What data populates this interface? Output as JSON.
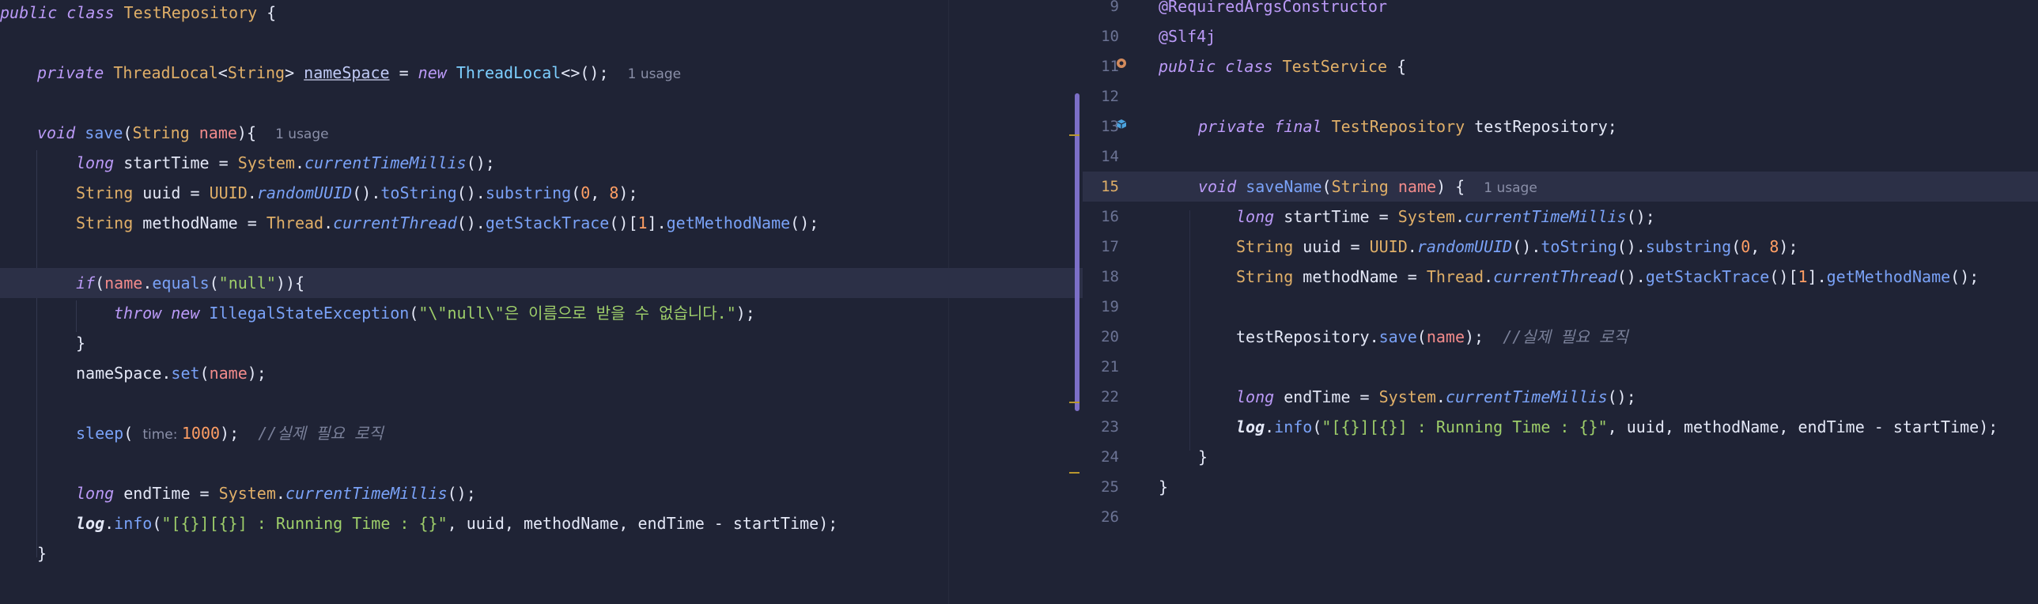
{
  "left_editor": {
    "lines": [
      {
        "segs": [
          [
            "k",
            "public class "
          ],
          [
            "b",
            "TestRepository "
          ],
          [
            "p",
            "{"
          ]
        ]
      },
      {
        "segs": []
      },
      {
        "segs": [
          [
            "k",
            "private "
          ],
          [
            "b",
            "ThreadLocal"
          ],
          [
            "p",
            "<"
          ],
          [
            "b",
            "String"
          ],
          [
            "p",
            "> "
          ],
          [
            "u",
            "nameSpace"
          ],
          [
            "p",
            " = "
          ],
          [
            "k",
            "new "
          ],
          [
            "cls",
            "ThreadLocal"
          ],
          [
            "p",
            "<>();  "
          ],
          [
            "hint",
            "1 usage"
          ]
        ]
      },
      {
        "segs": []
      },
      {
        "segs": [
          [
            "k",
            "void "
          ],
          [
            "f",
            "save"
          ],
          [
            "p",
            "("
          ],
          [
            "b",
            "String "
          ],
          [
            "pr",
            "name"
          ],
          [
            "p",
            "){  "
          ],
          [
            "hint",
            "1 usage"
          ]
        ]
      },
      {
        "segs": [
          [
            "k",
            "long "
          ],
          [
            "p",
            "startTime = "
          ],
          [
            "b",
            "System"
          ],
          [
            "p",
            "."
          ],
          [
            "kf",
            "currentTimeMillis"
          ],
          [
            "p",
            "();"
          ]
        ]
      },
      {
        "segs": [
          [
            "b",
            "String "
          ],
          [
            "p",
            "uuid = "
          ],
          [
            "b",
            "UUID"
          ],
          [
            "p",
            "."
          ],
          [
            "kf",
            "randomUUID"
          ],
          [
            "p",
            "()."
          ],
          [
            "f",
            "toString"
          ],
          [
            "p",
            "()."
          ],
          [
            "f",
            "substring"
          ],
          [
            "p",
            "("
          ],
          [
            "n",
            "0"
          ],
          [
            "p",
            ", "
          ],
          [
            "n",
            "8"
          ],
          [
            "p",
            ");"
          ]
        ]
      },
      {
        "segs": [
          [
            "b",
            "String "
          ],
          [
            "p",
            "methodName = "
          ],
          [
            "b",
            "Thread"
          ],
          [
            "p",
            "."
          ],
          [
            "kf",
            "currentThread"
          ],
          [
            "p",
            "()."
          ],
          [
            "f",
            "getStackTrace"
          ],
          [
            "p",
            "()["
          ],
          [
            "n",
            "1"
          ],
          [
            "p",
            "]."
          ],
          [
            "f",
            "getMethodName"
          ],
          [
            "p",
            "();"
          ]
        ]
      },
      {
        "segs": []
      },
      {
        "segs": [
          [
            "k",
            "if"
          ],
          [
            "p",
            "("
          ],
          [
            "pr",
            "name"
          ],
          [
            "p",
            "."
          ],
          [
            "f",
            "equals"
          ],
          [
            "p",
            "("
          ],
          [
            "s",
            "\"null\""
          ],
          [
            "p",
            ")){"
          ]
        ]
      },
      {
        "segs": [
          [
            "k",
            "throw new "
          ],
          [
            "f",
            "IllegalStateException"
          ],
          [
            "p",
            "("
          ],
          [
            "s",
            "\"\\\"null\\\"은 이름으로 받을 수 없습니다.\""
          ],
          [
            "p",
            ");"
          ]
        ]
      },
      {
        "segs": [
          [
            "p",
            "}"
          ]
        ]
      },
      {
        "segs": [
          [
            "p",
            "nameSpace."
          ],
          [
            "f",
            "set"
          ],
          [
            "p",
            "("
          ],
          [
            "pr",
            "name"
          ],
          [
            "p",
            ");"
          ]
        ]
      },
      {
        "segs": []
      },
      {
        "segs": [
          [
            "f",
            "sleep"
          ],
          [
            "p",
            "( "
          ],
          [
            "hint",
            "time: "
          ],
          [
            "n",
            "1000"
          ],
          [
            "p",
            ");  "
          ],
          [
            "c",
            "//실제 필요 로직"
          ]
        ]
      },
      {
        "segs": []
      },
      {
        "segs": [
          [
            "k",
            "long "
          ],
          [
            "p",
            "endTime = "
          ],
          [
            "b",
            "System"
          ],
          [
            "p",
            "."
          ],
          [
            "kf",
            "currentTimeMillis"
          ],
          [
            "p",
            "();"
          ]
        ]
      },
      {
        "segs": [
          [
            "lg",
            "log"
          ],
          [
            "p",
            "."
          ],
          [
            "f",
            "info"
          ],
          [
            "p",
            "("
          ],
          [
            "s",
            "\"[{}][{}] : Running Time : {}\""
          ],
          [
            "p",
            ", uuid, methodName, endTime - startTime);"
          ]
        ]
      },
      {
        "segs": [
          [
            "p",
            "}"
          ]
        ]
      }
    ]
  },
  "right_editor": {
    "lines": [
      {
        "num": "9",
        "segs": [
          [
            "an",
            "@RequiredArgsConstructor"
          ]
        ]
      },
      {
        "num": "10",
        "segs": [
          [
            "an",
            "@Slf4j"
          ]
        ]
      },
      {
        "num": "11",
        "segs": [
          [
            "k",
            "public class "
          ],
          [
            "b",
            "TestService "
          ],
          [
            "p",
            "{"
          ]
        ]
      },
      {
        "num": "12",
        "segs": []
      },
      {
        "num": "13",
        "segs": [
          [
            "k",
            "private final "
          ],
          [
            "b",
            "TestRepository "
          ],
          [
            "p",
            "testRepository;"
          ]
        ]
      },
      {
        "num": "14",
        "segs": []
      },
      {
        "num": "15",
        "segs": [
          [
            "k",
            "void "
          ],
          [
            "f",
            "saveName"
          ],
          [
            "p",
            "("
          ],
          [
            "b",
            "String "
          ],
          [
            "pr",
            "name"
          ],
          [
            "p",
            ") {  "
          ],
          [
            "hint",
            "1 usage"
          ]
        ]
      },
      {
        "num": "16",
        "segs": [
          [
            "k",
            "long "
          ],
          [
            "p",
            "startTime = "
          ],
          [
            "b",
            "System"
          ],
          [
            "p",
            "."
          ],
          [
            "kf",
            "currentTimeMillis"
          ],
          [
            "p",
            "();"
          ]
        ]
      },
      {
        "num": "17",
        "segs": [
          [
            "b",
            "String "
          ],
          [
            "p",
            "uuid = "
          ],
          [
            "b",
            "UUID"
          ],
          [
            "p",
            "."
          ],
          [
            "kf",
            "randomUUID"
          ],
          [
            "p",
            "()."
          ],
          [
            "f",
            "toString"
          ],
          [
            "p",
            "()."
          ],
          [
            "f",
            "substring"
          ],
          [
            "p",
            "("
          ],
          [
            "n",
            "0"
          ],
          [
            "p",
            ", "
          ],
          [
            "n",
            "8"
          ],
          [
            "p",
            ");"
          ]
        ]
      },
      {
        "num": "18",
        "segs": [
          [
            "b",
            "String "
          ],
          [
            "p",
            "methodName = "
          ],
          [
            "b",
            "Thread"
          ],
          [
            "p",
            "."
          ],
          [
            "kf",
            "currentThread"
          ],
          [
            "p",
            "()."
          ],
          [
            "f",
            "getStackTrace"
          ],
          [
            "p",
            "()["
          ],
          [
            "n",
            "1"
          ],
          [
            "p",
            "]."
          ],
          [
            "f",
            "getMethodName"
          ],
          [
            "p",
            "();"
          ]
        ]
      },
      {
        "num": "19",
        "segs": []
      },
      {
        "num": "20",
        "segs": [
          [
            "p",
            "testRepository."
          ],
          [
            "f",
            "save"
          ],
          [
            "p",
            "("
          ],
          [
            "pr",
            "name"
          ],
          [
            "p",
            ");  "
          ],
          [
            "c",
            "//실제 필요 로직"
          ]
        ]
      },
      {
        "num": "21",
        "segs": []
      },
      {
        "num": "22",
        "segs": [
          [
            "k",
            "long "
          ],
          [
            "p",
            "endTime = "
          ],
          [
            "b",
            "System"
          ],
          [
            "p",
            "."
          ],
          [
            "kf",
            "currentTimeMillis"
          ],
          [
            "p",
            "();"
          ]
        ]
      },
      {
        "num": "23",
        "segs": [
          [
            "lg",
            "log"
          ],
          [
            "p",
            "."
          ],
          [
            "f",
            "info"
          ],
          [
            "p",
            "("
          ],
          [
            "s",
            "\"[{}][{}] : Running Time : {}\""
          ],
          [
            "p",
            ", uuid, methodName, endTime - startTime);"
          ]
        ]
      },
      {
        "num": "24",
        "segs": [
          [
            "p",
            "}"
          ]
        ]
      },
      {
        "num": "25",
        "segs": [
          [
            "p",
            "}"
          ]
        ]
      },
      {
        "num": "26",
        "segs": []
      }
    ]
  },
  "icons": {
    "left_gutter": "lightbulb-icon",
    "right_gutter_11": "implemented-icon",
    "right_gutter_13": "bean-icon"
  }
}
